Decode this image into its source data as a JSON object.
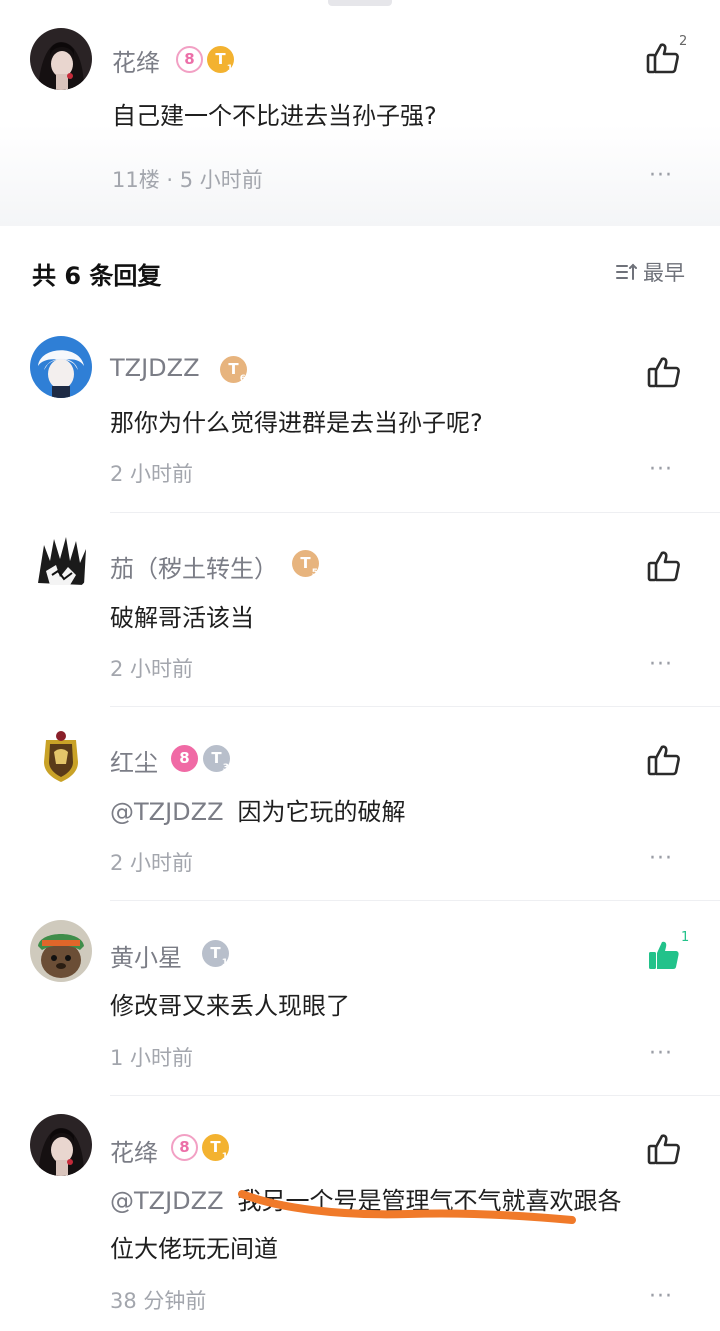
{
  "main_comment": {
    "username": "花绛",
    "badge_lv": "8",
    "badge_t": "T",
    "badge_t_sub": "1",
    "text": "自己建一个不比进去当孙子强?",
    "meta": "11楼 · 5 小时前",
    "like_count": "2"
  },
  "replies_header": {
    "title": "共 6 条回复",
    "sort_label": "最早"
  },
  "replies": [
    {
      "username": "TZJDZZ",
      "badge_t": "T",
      "badge_sub": "6",
      "text": "那你为什么觉得进群是去当孙子呢?",
      "meta": "2 小时前"
    },
    {
      "username": "茄（秽土转生）",
      "badge_t": "T",
      "badge_sub": "5",
      "text": "破解哥活该当",
      "meta": "2 小时前"
    },
    {
      "username": "红尘",
      "badge_lv": "8",
      "badge_t": "T",
      "badge_sub": "3",
      "mention": "@TZJDZZ",
      "text": "因为它玩的破解",
      "meta": "2 小时前"
    },
    {
      "username": "黄小星",
      "badge_t": "T",
      "badge_sub": "1",
      "text": "修改哥又来丢人现眼了",
      "meta": "1 小时前",
      "like_count": "1"
    },
    {
      "username": "花绛",
      "badge_lv": "8",
      "badge_t": "T",
      "badge_sub": "1",
      "mention": "@TZJDZZ",
      "text": "我另一个号是管理气不气就喜欢跟各",
      "text2": "位大佬玩无间道",
      "meta": "38 分钟前"
    }
  ],
  "more_glyph": "···",
  "colors": {
    "accent_green": "#22c28a",
    "underline_orange": "#f07a2a",
    "meta_gray": "#a3a6ad"
  }
}
